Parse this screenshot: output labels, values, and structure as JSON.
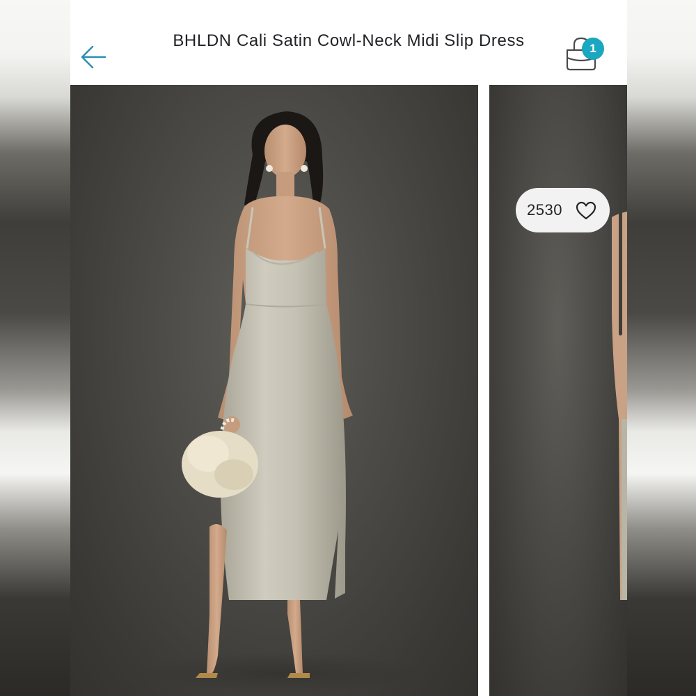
{
  "header": {
    "title": "BHLDN Cali Satin Cowl-Neck Midi Slip Dress",
    "back_icon": "arrow-left-icon",
    "bag_icon": "shopping-bag-icon",
    "bag_count": "1"
  },
  "gallery": {
    "like_count": "2530",
    "like_icon": "heart-outline-icon",
    "images": [
      {
        "name": "model-in-champagne-slip-dress-front"
      },
      {
        "name": "model-in-champagne-slip-dress-partial"
      }
    ]
  },
  "colors": {
    "accent": "#1aa7bf",
    "text": "#222326",
    "back_arrow": "#2a8fb0",
    "backdrop": "#4a4945",
    "dress": "#c9c6b8"
  }
}
